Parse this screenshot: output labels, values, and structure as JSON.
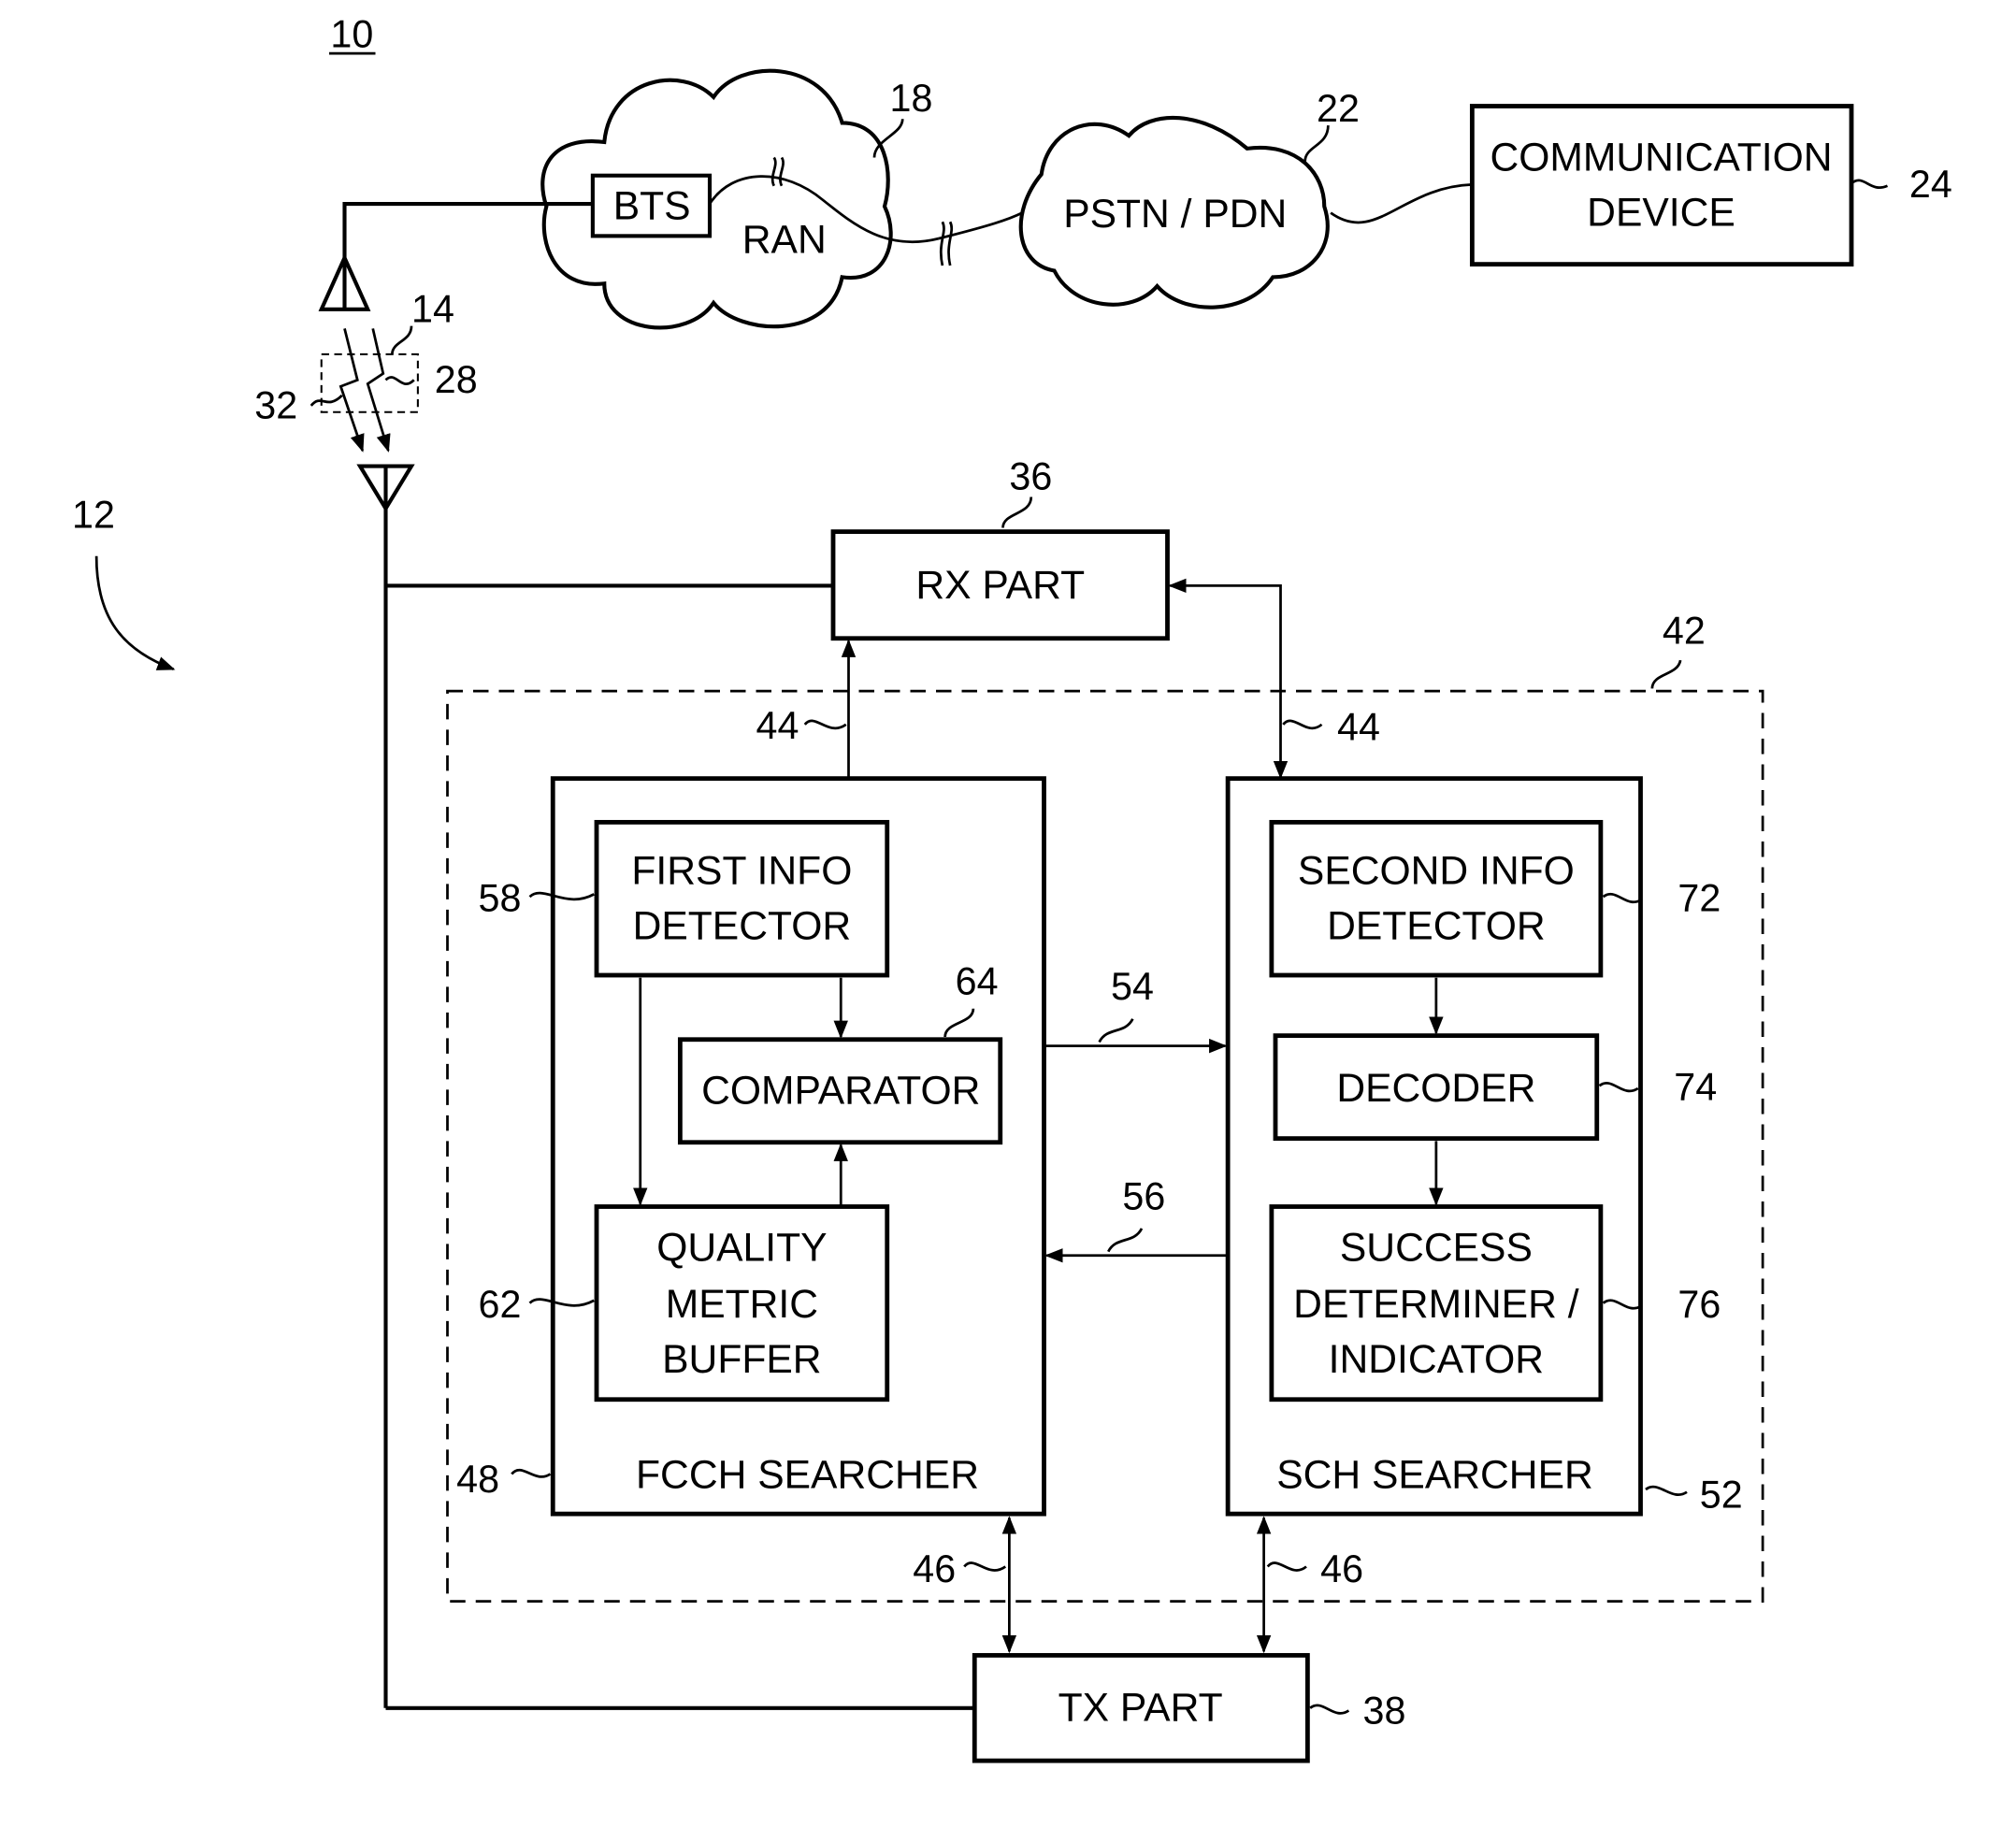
{
  "figure": {
    "ref": "10",
    "mobile_ref": "12"
  },
  "network": {
    "bts": "BTS",
    "ran": "RAN",
    "ran_ref": "18",
    "pstn": "PSTN / PDN",
    "pstn_ref": "22",
    "comm_device_line1": "COMMUNICATION",
    "comm_device_line2": "DEVICE",
    "comm_device_ref": "24"
  },
  "link": {
    "channel_ref": "14",
    "fcch_ref": "28",
    "sch_ref": "32"
  },
  "blocks": {
    "rx_part": "RX PART",
    "rx_ref": "36",
    "tx_part": "TX PART",
    "tx_ref": "38",
    "searcher_group_ref": "42",
    "rx_link_ref": "44",
    "tx_link_ref": "46",
    "fcch_searcher": "FCCH SEARCHER",
    "fcch_ref": "48",
    "sch_searcher": "SCH SEARCHER",
    "sch_ref": "52",
    "fwd_link_ref": "54",
    "back_link_ref": "56",
    "first_info_line1": "FIRST INFO",
    "first_info_line2": "DETECTOR",
    "first_info_ref": "58",
    "quality_line1": "QUALITY",
    "quality_line2": "METRIC",
    "quality_line3": "BUFFER",
    "quality_ref": "62",
    "comparator": "COMPARATOR",
    "comparator_ref": "64",
    "second_info_line1": "SECOND INFO",
    "second_info_line2": "DETECTOR",
    "second_info_ref": "72",
    "decoder": "DECODER",
    "decoder_ref": "74",
    "success_line1": "SUCCESS",
    "success_line2": "DETERMINER /",
    "success_line3": "INDICATOR",
    "success_ref": "76"
  }
}
